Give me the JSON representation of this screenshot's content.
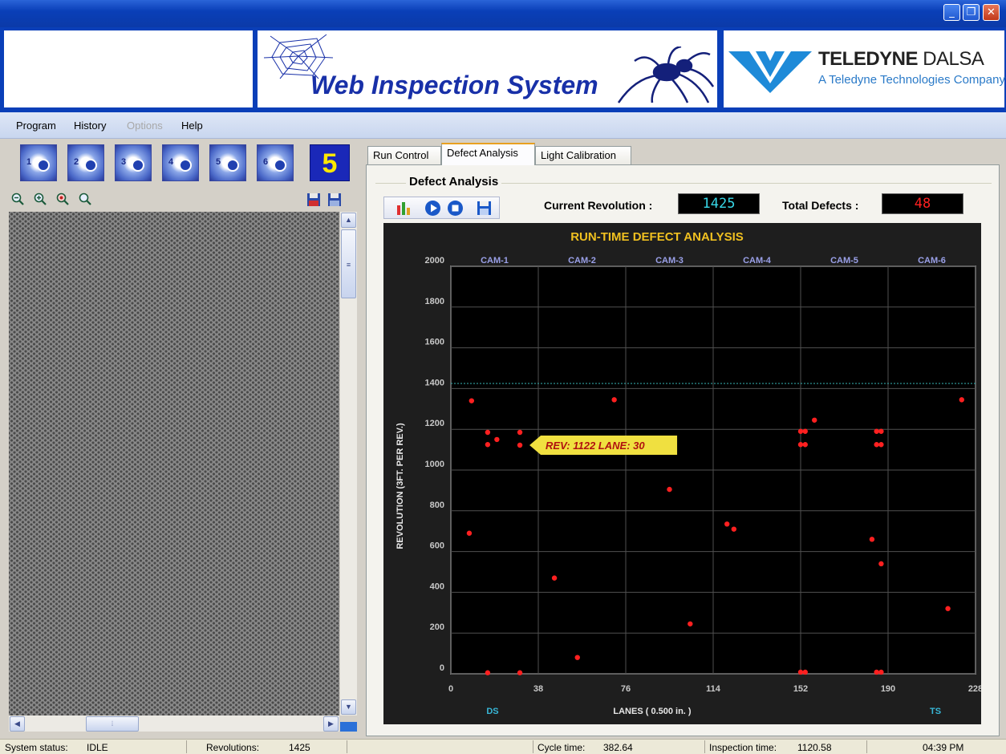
{
  "header": {
    "app_title": "Web Inspection System",
    "company": "TELEDYNE",
    "company_suffix": "DALSA",
    "company_sub": "A Teledyne Technologies Company"
  },
  "menu": [
    "Program",
    "History",
    "Options",
    "Help"
  ],
  "cameras": [
    "1",
    "2",
    "3",
    "4",
    "5",
    "6"
  ],
  "selected_camera": "5",
  "tabs": [
    "Run Control",
    "Defect Analysis",
    "Light Calibration"
  ],
  "active_tab": 1,
  "panel": {
    "title": "Defect Analysis",
    "current_revolution_label": "Current Revolution :",
    "current_revolution": "1425",
    "total_defects_label": "Total Defects :",
    "total_defects": "48"
  },
  "colors": {
    "lcd_cyan": "#38d8e8",
    "lcd_red": "#ff2020",
    "chart_title": "#f0c020",
    "cam_label": "#9aa0e8",
    "marker": "#ff2020",
    "tooltip_bg": "#f0e040",
    "tooltip_text": "#b01010"
  },
  "chart_data": {
    "type": "scatter",
    "title": "RUN-TIME DEFECT ANALYSIS",
    "xlabel": "LANES ( 0.500 in. )",
    "ylabel": "REVOLUTION (3FT. PER REV.)",
    "xlim": [
      0,
      228
    ],
    "ylim": [
      0,
      2000
    ],
    "x_ticks": [
      "0",
      "38",
      "76",
      "114",
      "152",
      "190",
      "228"
    ],
    "y_ticks": [
      "0",
      "200",
      "400",
      "600",
      "800",
      "1000",
      "1200",
      "1400",
      "1600",
      "1800",
      "2000"
    ],
    "grid": true,
    "camera_labels": [
      "CAM-1",
      "CAM-2",
      "CAM-3",
      "CAM-4",
      "CAM-5",
      "CAM-6"
    ],
    "edge_labels": [
      "DS",
      "TS"
    ],
    "current_revolution_line": 1425,
    "tooltip": "REV: 1122   LANE: 30",
    "points": [
      {
        "x": 8,
        "y": 690
      },
      {
        "x": 9,
        "y": 1340
      },
      {
        "x": 16,
        "y": 1185
      },
      {
        "x": 16,
        "y": 1125
      },
      {
        "x": 20,
        "y": 1150
      },
      {
        "x": 16,
        "y": 5
      },
      {
        "x": 30,
        "y": 1185
      },
      {
        "x": 30,
        "y": 1122
      },
      {
        "x": 30,
        "y": 5
      },
      {
        "x": 45,
        "y": 470
      },
      {
        "x": 55,
        "y": 80
      },
      {
        "x": 71,
        "y": 1345
      },
      {
        "x": 95,
        "y": 905
      },
      {
        "x": 104,
        "y": 245
      },
      {
        "x": 120,
        "y": 735
      },
      {
        "x": 123,
        "y": 710
      },
      {
        "x": 152,
        "y": 1190
      },
      {
        "x": 154,
        "y": 1190
      },
      {
        "x": 152,
        "y": 1125
      },
      {
        "x": 154,
        "y": 1125
      },
      {
        "x": 152,
        "y": 8
      },
      {
        "x": 154,
        "y": 8
      },
      {
        "x": 158,
        "y": 1245
      },
      {
        "x": 183,
        "y": 660
      },
      {
        "x": 185,
        "y": 1190
      },
      {
        "x": 187,
        "y": 1190
      },
      {
        "x": 185,
        "y": 1125
      },
      {
        "x": 187,
        "y": 1125
      },
      {
        "x": 187,
        "y": 540
      },
      {
        "x": 185,
        "y": 8
      },
      {
        "x": 187,
        "y": 8
      },
      {
        "x": 216,
        "y": 320
      },
      {
        "x": 222,
        "y": 1345
      }
    ]
  },
  "status": {
    "system_status_label": "System status:",
    "system_status": "IDLE",
    "revolutions_label": "Revolutions:",
    "revolutions": "1425",
    "cycle_time_label": "Cycle time:",
    "cycle_time": "382.64",
    "inspection_time_label": "Inspection time:",
    "inspection_time": "1120.58",
    "clock": "04:39 PM"
  }
}
